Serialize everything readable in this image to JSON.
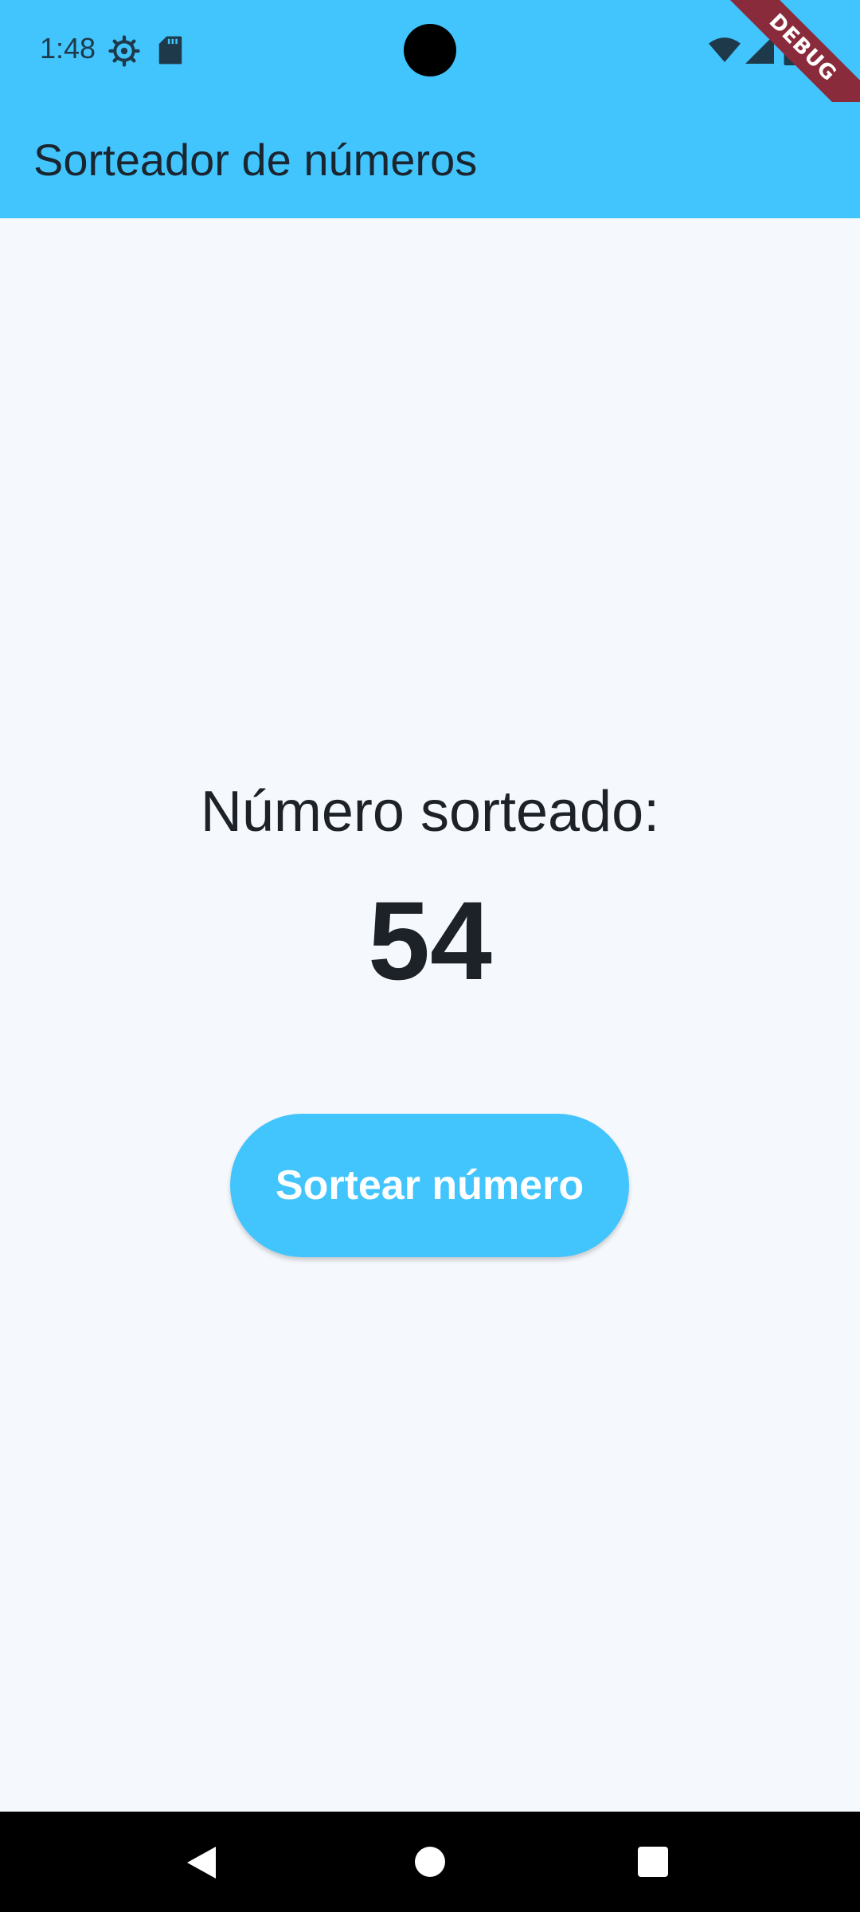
{
  "status_bar": {
    "time": "1:48",
    "icons": [
      "settings-gear-icon",
      "sd-card-icon",
      "wifi-icon",
      "cell-signal-icon",
      "battery-icon"
    ],
    "debug_label": "DEBUG"
  },
  "app_bar": {
    "title": "Sorteador de números"
  },
  "content": {
    "label": "Número sorteado:",
    "number": "54",
    "button_label": "Sortear número"
  },
  "nav_bar": {
    "icons": [
      "back-icon",
      "home-icon",
      "recents-icon"
    ]
  },
  "colors": {
    "accent": "#42c4fd",
    "background": "#f5f8fc",
    "text": "#1c2228",
    "debug_banner": "#8a2b3c"
  }
}
